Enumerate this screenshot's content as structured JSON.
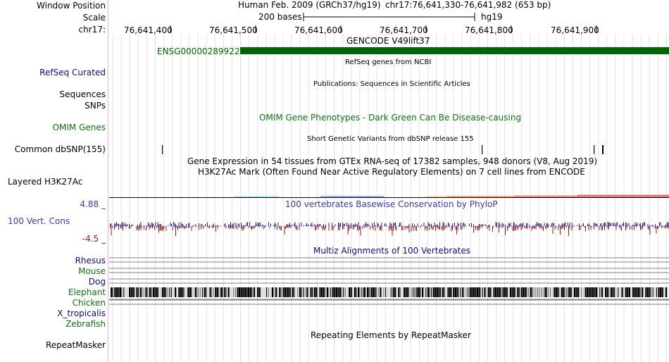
{
  "labels": {
    "window_position": "Window Position",
    "scale": "Scale",
    "chrom": "chr17:",
    "refseq": "RefSeq Curated",
    "sequences": "Sequences",
    "snps": "SNPs",
    "omim_genes": "OMIM Genes",
    "common_dbsnp": "Common dbSNP(155)",
    "layered_h3k27ac": "Layered H3K27Ac",
    "cons_max": "4.88 _",
    "cons_label": "100 Vert. Cons",
    "cons_min": "-4.5 _",
    "species": [
      "Rhesus",
      "Mouse",
      "Dog",
      "Elephant",
      "Chicken",
      "X_tropicalis",
      "Zebrafish"
    ],
    "repeatmasker": "RepeatMasker"
  },
  "header": {
    "assembly": "Human Feb. 2009 (GRCh37/hg19)",
    "position": "chr17:76,641,330-76,641,982 (653 bp)",
    "scale_text": "200 bases",
    "scale_db": "hg19",
    "ticks": [
      "76,641,400",
      "76,641,500",
      "76,641,600",
      "76,641,700",
      "76,641,800",
      "76,641,900"
    ]
  },
  "tracks": {
    "gencode_title": "GENCODE V49lift37",
    "gene_name": "ENSG00000289922",
    "refseq_title": "RefSeq genes from NCBI",
    "publications_title": "Publications: Sequences in Scientific Articles",
    "omim_title": "OMIM Gene Phenotypes - Dark Green Can Be Disease-causing",
    "dbsnp_title": "Short Genetic Variants from dbSNP release 155",
    "gtex_title": "Gene Expression in 54 tissues from GTEx RNA-seq of 17382 samples, 948 donors (V8, Aug 2019)",
    "h3k27ac_title": "H3K27Ac Mark (Often Found Near Active Regulatory Elements) on 7 cell lines from ENCODE",
    "phylop_title": "100 vertebrates Basewise Conservation by PhyloP",
    "multiz_title": "Multiz Alignments of 100 Vertebrates",
    "repeat_title": "Repeating Elements by RepeatMasker"
  },
  "colors": {
    "gene_green": "#006400",
    "omim_green": "#126e12",
    "label_navy": "#0c0c78",
    "cons_blue": "#3b3b9c",
    "cons_pos": "#1f1f8a",
    "cons_neg": "#8b1d1d",
    "grid": "#e0e0ec",
    "gutter_line": "#e6b8c3"
  }
}
